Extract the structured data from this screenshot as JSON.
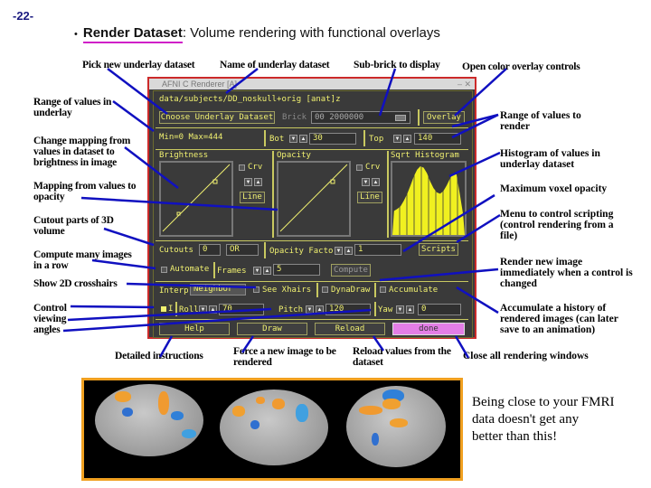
{
  "slide_number": "-22-",
  "title": {
    "bullet_icon": "pin-icon",
    "bold": "Render Dataset",
    "colon": ":",
    "rest": "Volume rendering with functional overlays"
  },
  "top_captions": [
    "Pick new underlay dataset",
    "Name of underlay dataset",
    "Sub-brick to display",
    "Open color overlay controls"
  ],
  "left_captions": [
    "Range of values in underlay",
    "Change mapping from values in dataset to brightness in image",
    "Mapping from values to opacity",
    "Cutout parts of 3D volume",
    "Compute many images in a row",
    "Show 2D crosshairs",
    "Control viewing angles"
  ],
  "right_captions": [
    "Range of values to render",
    "Histogram of values in underlay dataset",
    "Maximum voxel opacity",
    "Menu to control scripting (control rendering from a file)",
    "Render new image immediately when a control is changed",
    "Accumulate a history of rendered images (can later save to an animation)",
    "Close all rendering windows"
  ],
  "bottom_captions": [
    "Detailed instructions",
    "Force a new image to be rendered",
    "Reload values from the dataset"
  ],
  "window": {
    "title": "AFNI C Renderer [A]",
    "controls": "– ✕",
    "dataset_path": "data/subjects/DD_noskull+orig [anat]z",
    "choose_underlay_label": "Choose Underlay Dataset",
    "brick_label": "Brick",
    "brick_value": "00 2000000",
    "overlay_label": "Overlay",
    "minmax": "Min=0 Max=444",
    "bot_label": "Bot",
    "bot_value": "30",
    "top_label": "Top",
    "top_value": "140",
    "brightness_label": "Brightness",
    "opacity_label": "Opacity",
    "histogram_label": "Sqrt Histogram",
    "crv_label": "Crv",
    "line_label": "Line",
    "cutouts_label": "Cutouts",
    "cutouts_value": "0",
    "cutouts_logic": "OR",
    "opacity_factor_label": "Opacity Factor",
    "opacity_factor_value": "1",
    "scripts_label": "Scripts",
    "automate_label": "Automate",
    "frames_label": "Frames",
    "frames_value": "5",
    "compute_label": "Compute",
    "interp_label": "Interp",
    "interp_value": "Neighbor",
    "see_xhairs_label": "See Xhairs",
    "dynadraw_label": "DynaDraw",
    "accumulate_label": "Accumulate",
    "angle_toggle_label": "I",
    "roll_label": "Roll",
    "roll_value": "70",
    "pitch_label": "Pitch",
    "pitch_value": "120",
    "yaw_label": "Yaw",
    "yaw_value": "0",
    "help_label": "Help",
    "draw_label": "Draw",
    "reload_label": "Reload",
    "done_label": "done",
    "histogram_values": [
      0.35,
      0.38,
      0.42,
      0.5,
      0.6,
      0.72,
      0.85,
      0.95,
      1.0,
      0.98,
      0.9,
      0.78,
      0.68,
      0.62,
      0.6,
      0.64,
      0.72,
      0.82,
      0.9,
      0.88,
      0.6,
      0.3
    ]
  },
  "quote": [
    "Being close to your FMRI",
    "data doesn't get any",
    "better than this!"
  ],
  "colors": {
    "accent_underline": "#d020c8",
    "window_border": "#cc2a2a",
    "widget_text": "#f0f070",
    "done_button": "#e37ee6",
    "image_frame": "#f0a020",
    "leader_lines": "#1010c0"
  }
}
